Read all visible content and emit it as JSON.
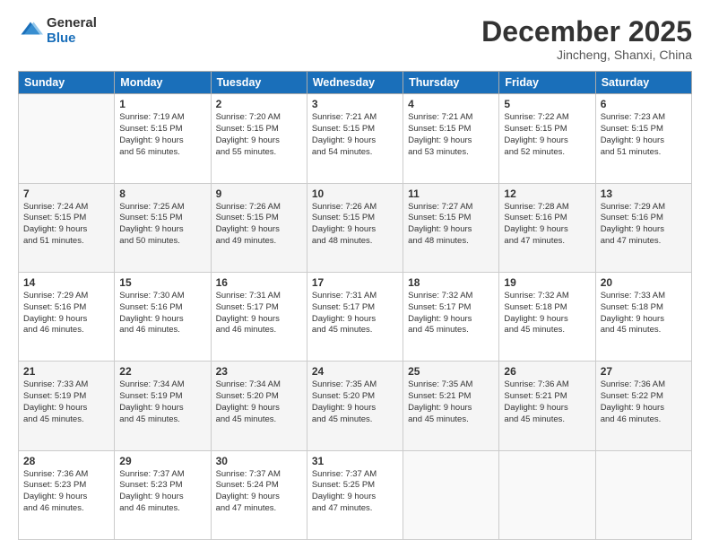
{
  "header": {
    "logo": {
      "general": "General",
      "blue": "Blue"
    },
    "title": "December 2025",
    "location": "Jincheng, Shanxi, China"
  },
  "days_of_week": [
    "Sunday",
    "Monday",
    "Tuesday",
    "Wednesday",
    "Thursday",
    "Friday",
    "Saturday"
  ],
  "weeks": [
    [
      {
        "day": "",
        "content": ""
      },
      {
        "day": "1",
        "content": "Sunrise: 7:19 AM\nSunset: 5:15 PM\nDaylight: 9 hours\nand 56 minutes."
      },
      {
        "day": "2",
        "content": "Sunrise: 7:20 AM\nSunset: 5:15 PM\nDaylight: 9 hours\nand 55 minutes."
      },
      {
        "day": "3",
        "content": "Sunrise: 7:21 AM\nSunset: 5:15 PM\nDaylight: 9 hours\nand 54 minutes."
      },
      {
        "day": "4",
        "content": "Sunrise: 7:21 AM\nSunset: 5:15 PM\nDaylight: 9 hours\nand 53 minutes."
      },
      {
        "day": "5",
        "content": "Sunrise: 7:22 AM\nSunset: 5:15 PM\nDaylight: 9 hours\nand 52 minutes."
      },
      {
        "day": "6",
        "content": "Sunrise: 7:23 AM\nSunset: 5:15 PM\nDaylight: 9 hours\nand 51 minutes."
      }
    ],
    [
      {
        "day": "7",
        "content": "Sunrise: 7:24 AM\nSunset: 5:15 PM\nDaylight: 9 hours\nand 51 minutes."
      },
      {
        "day": "8",
        "content": "Sunrise: 7:25 AM\nSunset: 5:15 PM\nDaylight: 9 hours\nand 50 minutes."
      },
      {
        "day": "9",
        "content": "Sunrise: 7:26 AM\nSunset: 5:15 PM\nDaylight: 9 hours\nand 49 minutes."
      },
      {
        "day": "10",
        "content": "Sunrise: 7:26 AM\nSunset: 5:15 PM\nDaylight: 9 hours\nand 48 minutes."
      },
      {
        "day": "11",
        "content": "Sunrise: 7:27 AM\nSunset: 5:15 PM\nDaylight: 9 hours\nand 48 minutes."
      },
      {
        "day": "12",
        "content": "Sunrise: 7:28 AM\nSunset: 5:16 PM\nDaylight: 9 hours\nand 47 minutes."
      },
      {
        "day": "13",
        "content": "Sunrise: 7:29 AM\nSunset: 5:16 PM\nDaylight: 9 hours\nand 47 minutes."
      }
    ],
    [
      {
        "day": "14",
        "content": "Sunrise: 7:29 AM\nSunset: 5:16 PM\nDaylight: 9 hours\nand 46 minutes."
      },
      {
        "day": "15",
        "content": "Sunrise: 7:30 AM\nSunset: 5:16 PM\nDaylight: 9 hours\nand 46 minutes."
      },
      {
        "day": "16",
        "content": "Sunrise: 7:31 AM\nSunset: 5:17 PM\nDaylight: 9 hours\nand 46 minutes."
      },
      {
        "day": "17",
        "content": "Sunrise: 7:31 AM\nSunset: 5:17 PM\nDaylight: 9 hours\nand 45 minutes."
      },
      {
        "day": "18",
        "content": "Sunrise: 7:32 AM\nSunset: 5:17 PM\nDaylight: 9 hours\nand 45 minutes."
      },
      {
        "day": "19",
        "content": "Sunrise: 7:32 AM\nSunset: 5:18 PM\nDaylight: 9 hours\nand 45 minutes."
      },
      {
        "day": "20",
        "content": "Sunrise: 7:33 AM\nSunset: 5:18 PM\nDaylight: 9 hours\nand 45 minutes."
      }
    ],
    [
      {
        "day": "21",
        "content": "Sunrise: 7:33 AM\nSunset: 5:19 PM\nDaylight: 9 hours\nand 45 minutes."
      },
      {
        "day": "22",
        "content": "Sunrise: 7:34 AM\nSunset: 5:19 PM\nDaylight: 9 hours\nand 45 minutes."
      },
      {
        "day": "23",
        "content": "Sunrise: 7:34 AM\nSunset: 5:20 PM\nDaylight: 9 hours\nand 45 minutes."
      },
      {
        "day": "24",
        "content": "Sunrise: 7:35 AM\nSunset: 5:20 PM\nDaylight: 9 hours\nand 45 minutes."
      },
      {
        "day": "25",
        "content": "Sunrise: 7:35 AM\nSunset: 5:21 PM\nDaylight: 9 hours\nand 45 minutes."
      },
      {
        "day": "26",
        "content": "Sunrise: 7:36 AM\nSunset: 5:21 PM\nDaylight: 9 hours\nand 45 minutes."
      },
      {
        "day": "27",
        "content": "Sunrise: 7:36 AM\nSunset: 5:22 PM\nDaylight: 9 hours\nand 46 minutes."
      }
    ],
    [
      {
        "day": "28",
        "content": "Sunrise: 7:36 AM\nSunset: 5:23 PM\nDaylight: 9 hours\nand 46 minutes."
      },
      {
        "day": "29",
        "content": "Sunrise: 7:37 AM\nSunset: 5:23 PM\nDaylight: 9 hours\nand 46 minutes."
      },
      {
        "day": "30",
        "content": "Sunrise: 7:37 AM\nSunset: 5:24 PM\nDaylight: 9 hours\nand 47 minutes."
      },
      {
        "day": "31",
        "content": "Sunrise: 7:37 AM\nSunset: 5:25 PM\nDaylight: 9 hours\nand 47 minutes."
      },
      {
        "day": "",
        "content": ""
      },
      {
        "day": "",
        "content": ""
      },
      {
        "day": "",
        "content": ""
      }
    ]
  ]
}
